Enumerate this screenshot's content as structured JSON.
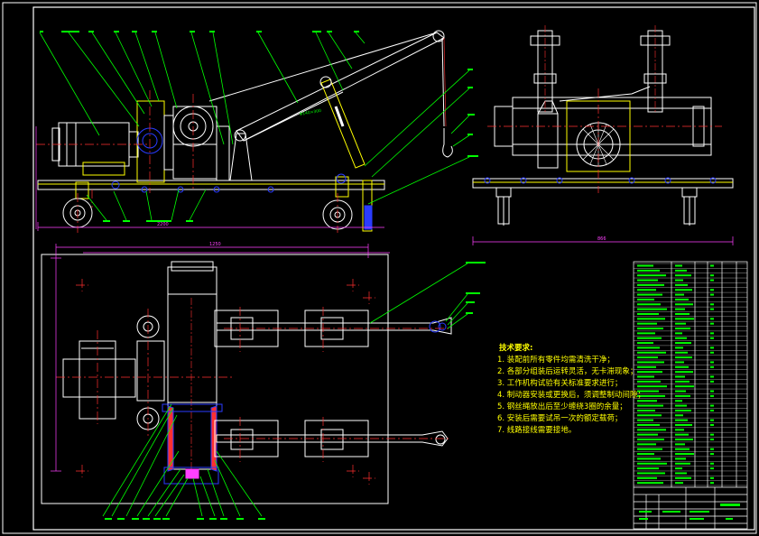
{
  "drawing": {
    "tech_title": "技术要求:",
    "tech_requirements": [
      "1. 装配前所有零件均需清洗干净；",
      "2. 各部分组装后运转灵活，无卡滞现象；",
      "3. 工作机构试验有关标准要求进行；",
      "4. 制动器安装或更换后，须调整制动间隙；",
      "5. 钢丝绳放出后至少缠绕3圈的余量；",
      "6. 安装后需要试吊一次的额定载荷；",
      "7. 线路接线需要接地。"
    ],
    "dim_front": "2200",
    "dim_side": "866",
    "dim_plan": "1250",
    "boom_label": "Φ140×300",
    "colors": {
      "frame": "#ffffff",
      "outline": "#ffff00",
      "leader": "#00ff00",
      "center": "#ff3030",
      "hidden": "#2a3cff",
      "dim": "#ff40ff"
    }
  }
}
